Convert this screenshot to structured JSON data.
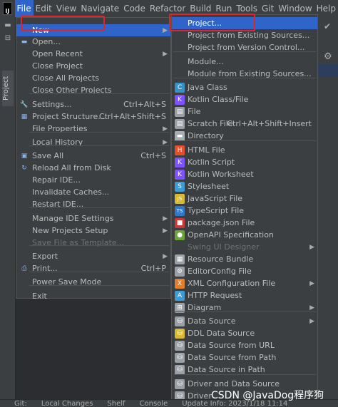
{
  "menubar": {
    "logo": "IJ",
    "items": [
      "File",
      "Edit",
      "View",
      "Navigate",
      "Code",
      "Refactor",
      "Build",
      "Run",
      "Tools",
      "Git",
      "Window",
      "Help"
    ]
  },
  "sidebar": {
    "project_tab": "Project"
  },
  "file_menu": [
    {
      "label": "New",
      "arrow": true,
      "selected": true
    },
    {
      "label": "Open...",
      "icon": "folder"
    },
    {
      "label": "Open Recent",
      "arrow": true
    },
    {
      "label": "Close Project"
    },
    {
      "label": "Close All Projects"
    },
    {
      "label": "Close Other Projects"
    },
    {
      "label": "Settings...",
      "shortcut": "Ctrl+Alt+S",
      "icon": "wrench"
    },
    {
      "label": "Project Structure...",
      "shortcut": "Ctrl+Alt+Shift+S",
      "icon": "structure"
    },
    {
      "label": "File Properties",
      "arrow": true
    },
    {
      "label": "Local History",
      "arrow": true
    },
    {
      "label": "Save All",
      "shortcut": "Ctrl+S",
      "icon": "save"
    },
    {
      "label": "Reload All from Disk",
      "icon": "reload"
    },
    {
      "label": "Repair IDE..."
    },
    {
      "label": "Invalidate Caches..."
    },
    {
      "label": "Restart IDE..."
    },
    {
      "label": "Manage IDE Settings",
      "arrow": true
    },
    {
      "label": "New Projects Setup",
      "arrow": true
    },
    {
      "label": "Save File as Template...",
      "disabled": true
    },
    {
      "label": "Export",
      "arrow": true
    },
    {
      "label": "Print...",
      "shortcut": "Ctrl+P",
      "icon": "print"
    },
    {
      "label": "Power Save Mode"
    },
    {
      "label": "Exit"
    }
  ],
  "new_menu": [
    {
      "label": "Project...",
      "selected": true
    },
    {
      "label": "Project from Existing Sources..."
    },
    {
      "label": "Project from Version Control..."
    },
    {
      "label": "Module..."
    },
    {
      "label": "Module from Existing Sources..."
    },
    {
      "label": "Java Class",
      "icon": "C",
      "icon_color": "#3592c4"
    },
    {
      "label": "Kotlin Class/File",
      "icon": "K",
      "icon_color": "#7f52ff"
    },
    {
      "label": "File",
      "icon": "▤",
      "icon_color": "#9aa0a6"
    },
    {
      "label": "Scratch File",
      "shortcut": "Ctrl+Alt+Shift+Insert",
      "icon": "▤",
      "icon_color": "#9aa0a6"
    },
    {
      "label": "Directory",
      "icon": "▬",
      "icon_color": "#a8adb3"
    },
    {
      "label": "HTML File",
      "icon": "H",
      "icon_color": "#e44d26"
    },
    {
      "label": "Kotlin Script",
      "icon": "K",
      "icon_color": "#7f52ff"
    },
    {
      "label": "Kotlin Worksheet",
      "icon": "K",
      "icon_color": "#7f52ff"
    },
    {
      "label": "Stylesheet",
      "icon": "S",
      "icon_color": "#3d9bd8"
    },
    {
      "label": "JavaScript File",
      "icon": "JS",
      "icon_color": "#d8b930"
    },
    {
      "label": "TypeScript File",
      "icon": "TS",
      "icon_color": "#3178c6"
    },
    {
      "label": "package.json File",
      "icon": "■",
      "icon_color": "#cb3837"
    },
    {
      "label": "OpenAPI Specification",
      "icon": "●",
      "icon_color": "#6ba539"
    },
    {
      "label": "Swing UI Designer",
      "arrow": true,
      "disabled": true
    },
    {
      "label": "Resource Bundle",
      "icon": "▦",
      "icon_color": "#9aa0a6"
    },
    {
      "label": "EditorConfig File",
      "icon": "⚙",
      "icon_color": "#9aa0a6"
    },
    {
      "label": "XML Configuration File",
      "arrow": true,
      "icon": "X",
      "icon_color": "#e27f2e"
    },
    {
      "label": "HTTP Request",
      "icon": "A",
      "icon_color": "#3d9bd8"
    },
    {
      "label": "Diagram",
      "arrow": true,
      "icon": "⊞",
      "icon_color": "#9aa0a6"
    },
    {
      "label": "Data Source",
      "arrow": true,
      "icon": "⛁",
      "icon_color": "#9aa0a6"
    },
    {
      "label": "DDL Data Source",
      "icon": "⛁",
      "icon_color": "#d8b930"
    },
    {
      "label": "Data Source from URL",
      "icon": "⛁",
      "icon_color": "#9aa0a6"
    },
    {
      "label": "Data Source from Path",
      "icon": "⛁",
      "icon_color": "#9aa0a6"
    },
    {
      "label": "Data Source in Path",
      "icon": "⛁",
      "icon_color": "#9aa0a6"
    },
    {
      "label": "Driver and Data Source",
      "icon": "⛁",
      "icon_color": "#9aa0a6"
    },
    {
      "label": "Driver",
      "icon": "⛁",
      "icon_color": "#9aa0a6"
    }
  ],
  "statusbar": {
    "items": [
      "Git:",
      "Local Changes",
      "Shelf",
      "Console",
      "Update Info: 2023/1/18 11:14"
    ]
  },
  "watermark": "CSDN @JavaDog程序狗"
}
